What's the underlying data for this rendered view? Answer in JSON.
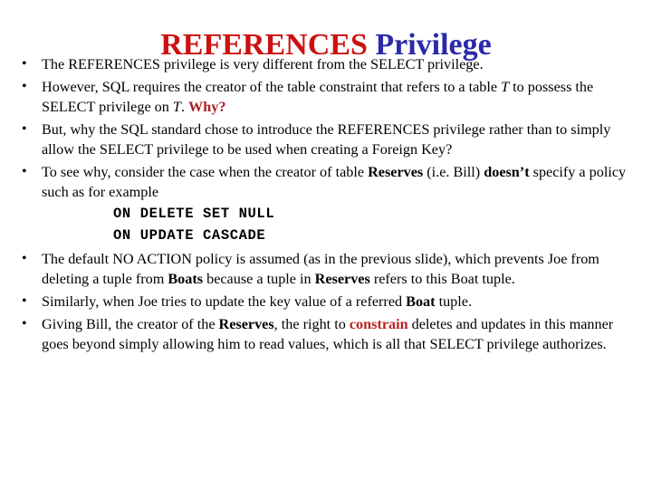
{
  "slide": {
    "title": {
      "primary": "REFERENCES",
      "secondary": "Privilege",
      "primary_color": "#CC1111",
      "secondary_color": "#2A2AA8"
    },
    "bullet_marker": "•",
    "bullets": [
      {
        "id": "bullet-1",
        "runs": [
          {
            "text": "The REFERENCES privilege is very different from the SELECT privilege.",
            "style": "normal"
          }
        ]
      },
      {
        "id": "bullet-2",
        "runs": [
          {
            "text": "However, SQL requires the creator of the table constraint that refers to a table ",
            "style": "normal"
          },
          {
            "text": "T",
            "style": "italic"
          },
          {
            "text": " to possess the SELECT privilege on ",
            "style": "normal"
          },
          {
            "text": "T",
            "style": "italic"
          },
          {
            "text": ". ",
            "style": "normal"
          },
          {
            "text": "Why?",
            "style": "red-accent"
          }
        ]
      },
      {
        "id": "bullet-3",
        "runs": [
          {
            "text": "But, why the SQL standard chose to introduce the REFERENCES privilege rather than to simply allow the SELECT privilege to be used when creating a Foreign Key?",
            "style": "normal"
          }
        ]
      },
      {
        "id": "bullet-4",
        "runs": [
          {
            "text": "To see why, consider the case when the creator of table ",
            "style": "normal"
          },
          {
            "text": "Reserves",
            "style": "bold"
          },
          {
            "text": " (i.e. Bill) ",
            "style": "normal"
          },
          {
            "text": "doesn’t",
            "style": "bold"
          },
          {
            "text": " specify a policy such as for example",
            "style": "normal"
          }
        ],
        "code_lines": [
          "ON DELETE SET NULL",
          "ON UPDATE CASCADE"
        ]
      },
      {
        "id": "bullet-5",
        "runs": [
          {
            "text": "The default NO ACTION policy is assumed (as in the previous slide), which prevents Joe from deleting a tuple from ",
            "style": "normal"
          },
          {
            "text": "Boats",
            "style": "bold"
          },
          {
            "text": " because a tuple in ",
            "style": "normal"
          },
          {
            "text": "Reserves",
            "style": "bold"
          },
          {
            "text": " refers to this Boat tuple.",
            "style": "normal"
          }
        ]
      },
      {
        "id": "bullet-6",
        "runs": [
          {
            "text": "Similarly, when Joe tries to update the key value of a referred ",
            "style": "normal"
          },
          {
            "text": "Boat",
            "style": "bold"
          },
          {
            "text": " tuple.",
            "style": "normal"
          }
        ]
      },
      {
        "id": "bullet-7",
        "runs": [
          {
            "text": "Giving Bill, the creator of the ",
            "style": "normal"
          },
          {
            "text": "Reserves",
            "style": "bold"
          },
          {
            "text": ", the right to ",
            "style": "normal"
          },
          {
            "text": "constrain",
            "style": "red-word"
          },
          {
            "text": " deletes and updates in this manner goes beyond simply allowing him to read values, which is all that SELECT privilege authorizes.",
            "style": "normal"
          }
        ]
      }
    ]
  }
}
